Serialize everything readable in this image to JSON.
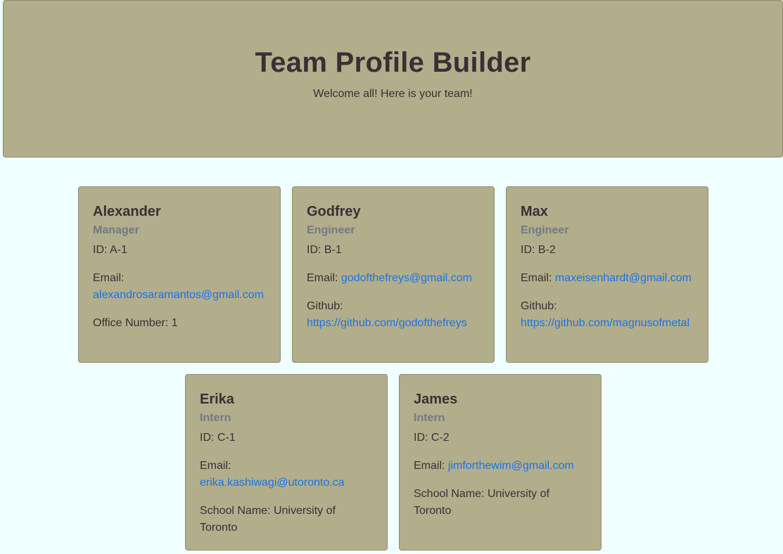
{
  "header": {
    "title": "Team Profile Builder",
    "subtitle": "Welcome all! Here is your team!"
  },
  "team": [
    {
      "name": "Alexander",
      "role": "Manager",
      "id_label": "ID: A-1",
      "email_label": "Email:",
      "email": "alexandrosaramantos@gmail.com",
      "extra_label": "Office Number: 1",
      "extra_link": ""
    },
    {
      "name": "Godfrey",
      "role": "Engineer",
      "id_label": "ID: B-1",
      "email_label": "Email:",
      "email": "godofthefreys@gmail.com",
      "extra_label": "Github:",
      "extra_link": "https://github.com/godofthefreys"
    },
    {
      "name": "Max",
      "role": "Engineer",
      "id_label": "ID: B-2",
      "email_label": "Email:",
      "email": "maxeisenhardt@gmail.com",
      "extra_label": "Github:",
      "extra_link": "https://github.com/magnusofmetal"
    },
    {
      "name": "Erika",
      "role": "Intern",
      "id_label": "ID: C-1",
      "email_label": "Email:",
      "email": "erika.kashiwagi@utoronto.ca",
      "extra_label": "School Name: University of Toronto",
      "extra_link": ""
    },
    {
      "name": "James",
      "role": "Intern",
      "id_label": "ID: C-2",
      "email_label": "Email:",
      "email": "jimforthewim@gmail.com",
      "extra_label": "School Name: University of Toronto",
      "extra_link": ""
    }
  ],
  "colors": {
    "page_background": "#f0ffff",
    "card_background": "#b2ae8c",
    "text": "#3a2f35",
    "role_text": "#707a85",
    "link": "#1a73e8"
  }
}
